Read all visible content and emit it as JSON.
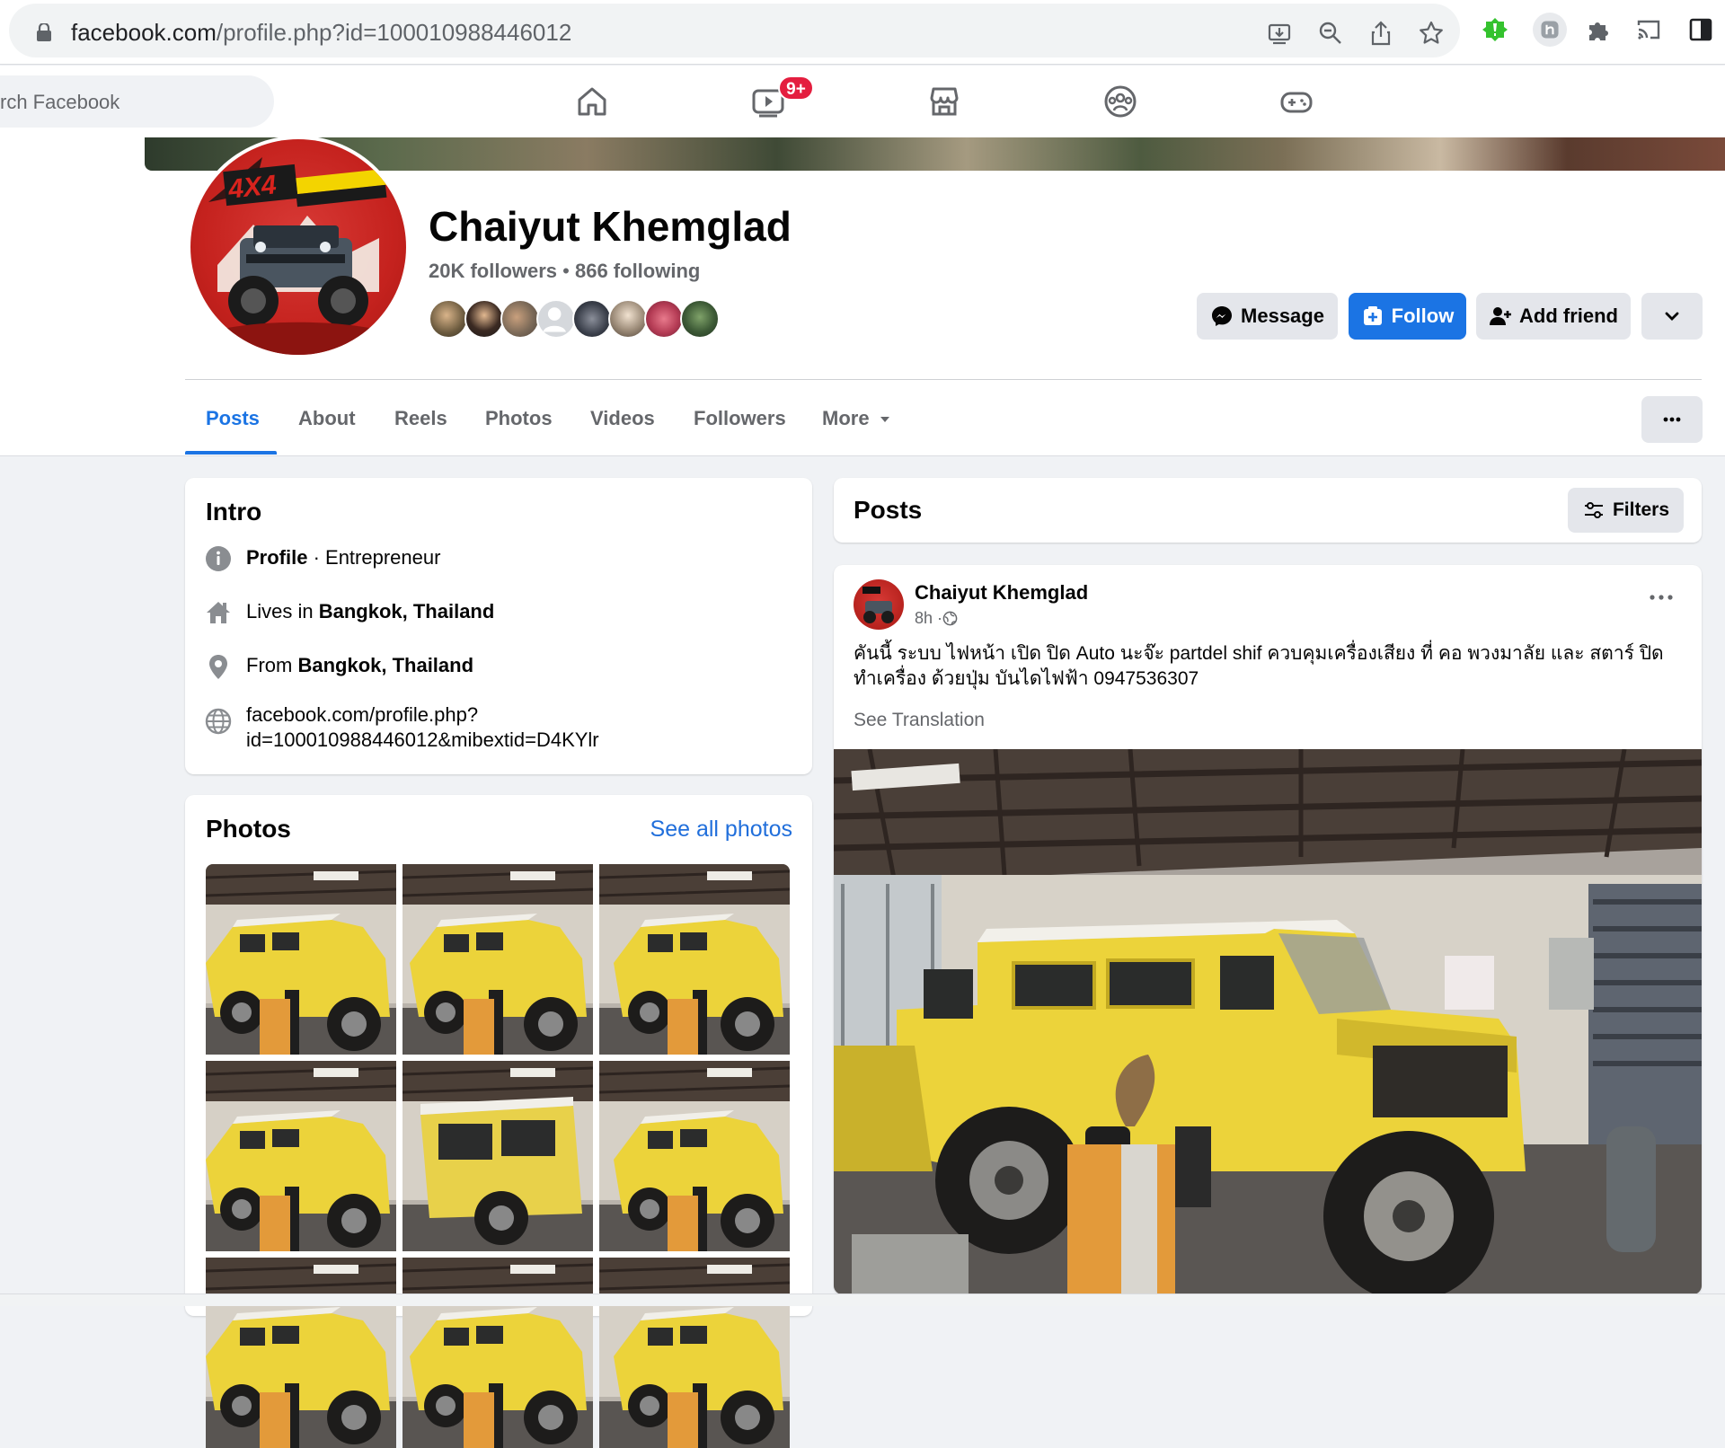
{
  "browser": {
    "url_host": "facebook.com",
    "url_path": "/profile.php?id=100010988446012"
  },
  "nav": {
    "search_placeholder": "rch Facebook",
    "watch_badge": "9+"
  },
  "profile": {
    "name": "Chaiyut Khemglad",
    "followers": "20K followers",
    "separator": " • ",
    "following": "866 following",
    "buttons": {
      "message": "Message",
      "follow": "Follow",
      "add_friend": "Add friend"
    }
  },
  "tabs": [
    {
      "label": "Posts",
      "active": true
    },
    {
      "label": "About"
    },
    {
      "label": "Reels"
    },
    {
      "label": "Photos"
    },
    {
      "label": "Videos"
    },
    {
      "label": "Followers"
    },
    {
      "label": "More"
    }
  ],
  "intro": {
    "title": "Intro",
    "profile_type_bold": "Profile",
    "profile_type_rest": " · Entrepreneur",
    "lives_prefix": "Lives in ",
    "lives_place": "Bangkok, Thailand",
    "from_prefix": "From ",
    "from_place": "Bangkok, Thailand",
    "link_line1": "facebook.com/profile.php?",
    "link_line2": "id=100010988446012&mibextid=D4KYlr"
  },
  "photos": {
    "title": "Photos",
    "see_all": "See all photos"
  },
  "posts_header": {
    "title": "Posts",
    "filters": "Filters"
  },
  "post": {
    "author": "Chaiyut Khemglad",
    "time": "8h · ",
    "text": "คันนี้ ระบบ ไฟหน้า เปิด ปิด Auto นะจ๊ะ partdel shif ควบคุมเครื่องเสียง ที่ คอ พวงมาลัย และ สตาร์ ปิด ทำเครื่อง ด้วยปุ่ม บันไดไฟฟ้า 0947536307",
    "see_translation": "See Translation"
  },
  "colors": {
    "fb_blue": "#1b74e4",
    "link_blue": "#216fdb",
    "badge_red": "#e41e3f",
    "background": "#f0f2f5"
  }
}
